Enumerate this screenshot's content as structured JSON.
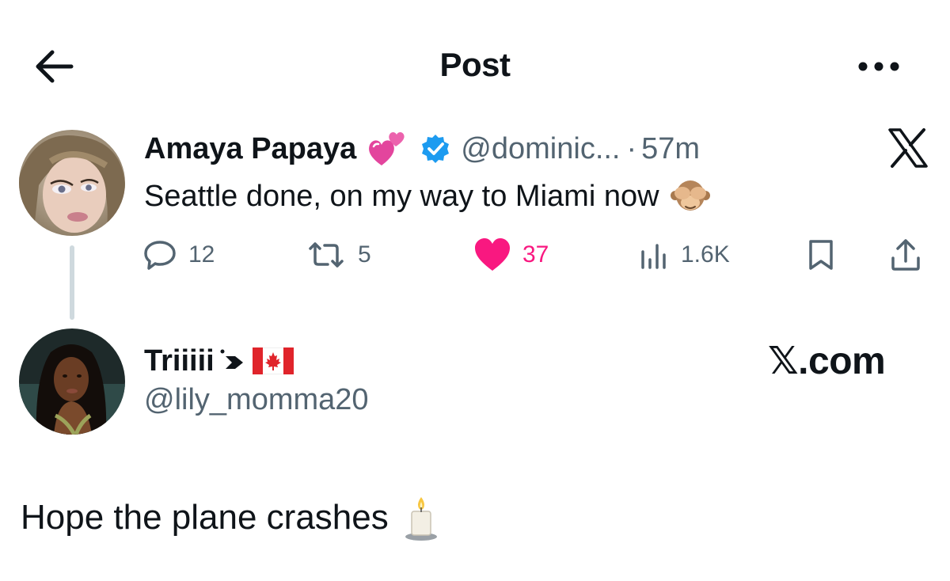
{
  "header": {
    "title": "Post",
    "back_icon": "arrow-left-icon",
    "more_icon": "more-horizontal-icon"
  },
  "original_post": {
    "display_name": "Amaya Papaya",
    "name_emoji": "two-hearts-emoji",
    "verified_icon": "verified-badge-icon",
    "handle": "@dominic...",
    "separator": "·",
    "time": "57m",
    "source_logo": "x-logo-icon",
    "text": "Seattle done, on my way to Miami now",
    "text_emoji": "see-no-evil-monkey-emoji",
    "actions": {
      "replies": "12",
      "reposts": "5",
      "likes": "37",
      "views": "1.6K"
    },
    "colors": {
      "like": "#f91880",
      "verified": "#1d9bf0",
      "muted": "#536471"
    }
  },
  "reply_post": {
    "display_name": "Triiiii",
    "name_decoration": "dot-and-right-arrow-emoji",
    "flag_emoji": "canada-flag-emoji",
    "handle": "@lily_momma20",
    "watermark": "𝕏.com",
    "text": "Hope the plane crashes",
    "text_emoji": "candle-emoji"
  }
}
